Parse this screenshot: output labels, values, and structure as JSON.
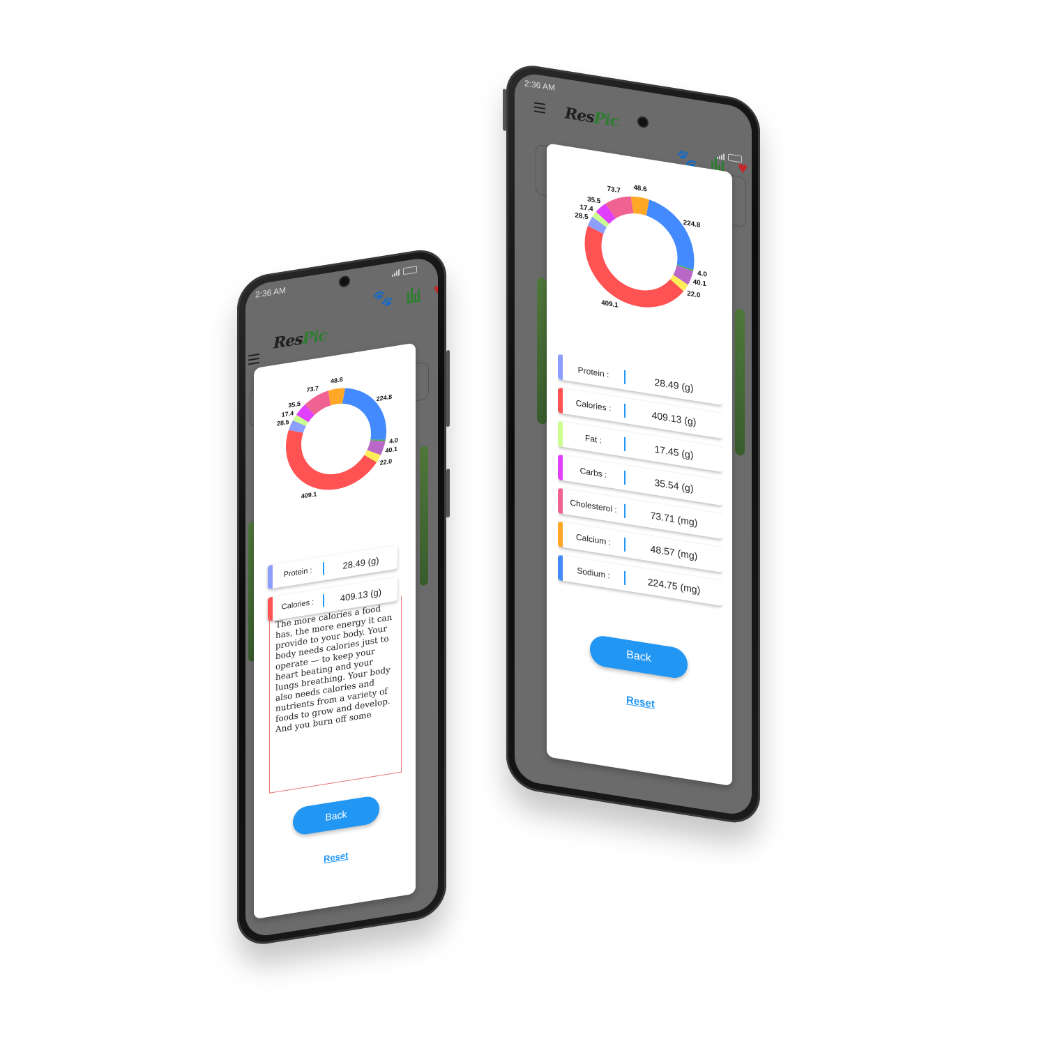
{
  "app": {
    "status_time": "2:36 AM",
    "logo_res": "Res",
    "logo_pic": "Pic",
    "toolbar_icons": [
      "paw-icon",
      "bar-chart-icon",
      "heart-icon"
    ],
    "menu_icon": "hamburger-icon"
  },
  "colors": {
    "protein": "#8c9eff",
    "calories": "#ff5252",
    "fat": "#ccff90",
    "carbs": "#e040fb",
    "cholesterol": "#f06292",
    "calcium": "#ffa726",
    "sodium": "#448aff",
    "iron": "#4caf50",
    "potassium": "#ba68c8",
    "vitamin": "#ffee58",
    "accent": "#2196f3"
  },
  "chart_data": {
    "type": "pie",
    "variant": "donut",
    "labels": [
      "224.8",
      "4.0",
      "40.1",
      "22.0",
      "409.1",
      "28.5",
      "17.4",
      "35.5",
      "73.7",
      "48.6"
    ],
    "values": [
      224.8,
      4.0,
      40.1,
      22.0,
      409.1,
      28.5,
      17.4,
      35.5,
      73.7,
      48.6
    ],
    "colors": [
      "#448aff",
      "#4caf50",
      "#ba68c8",
      "#ffee58",
      "#ff5252",
      "#8c9eff",
      "#ccff90",
      "#e040fb",
      "#f06292",
      "#ffa726"
    ]
  },
  "left_phone": {
    "nutrients": [
      {
        "label": "Protein :",
        "value": "28.49 (g)",
        "color": "#8c9eff"
      },
      {
        "label": "Calories :",
        "value": "409.13 (g)",
        "color": "#ff5252"
      }
    ],
    "description": "The more calories a food has, the more energy it can provide to your body. Your body needs calories just to operate — to keep your heart beating and your lungs breathing. Your body also needs calories and nutrients from a variety of foods to grow and develop. And you burn off some",
    "back_label": "Back",
    "reset_label": "Reset"
  },
  "right_phone": {
    "nutrients": [
      {
        "label": "Protein :",
        "value": "28.49 (g)",
        "color": "#8c9eff"
      },
      {
        "label": "Calories :",
        "value": "409.13 (g)",
        "color": "#ff5252"
      },
      {
        "label": "Fat :",
        "value": "17.45 (g)",
        "color": "#ccff90"
      },
      {
        "label": "Carbs :",
        "value": "35.54 (g)",
        "color": "#e040fb"
      },
      {
        "label": "Cholesterol :",
        "value": "73.71 (mg)",
        "color": "#f06292"
      },
      {
        "label": "Calcium :",
        "value": "48.57 (mg)",
        "color": "#ffa726"
      },
      {
        "label": "Sodium :",
        "value": "224.75 (mg)",
        "color": "#448aff"
      }
    ],
    "back_label": "Back",
    "reset_label": "Reset"
  }
}
